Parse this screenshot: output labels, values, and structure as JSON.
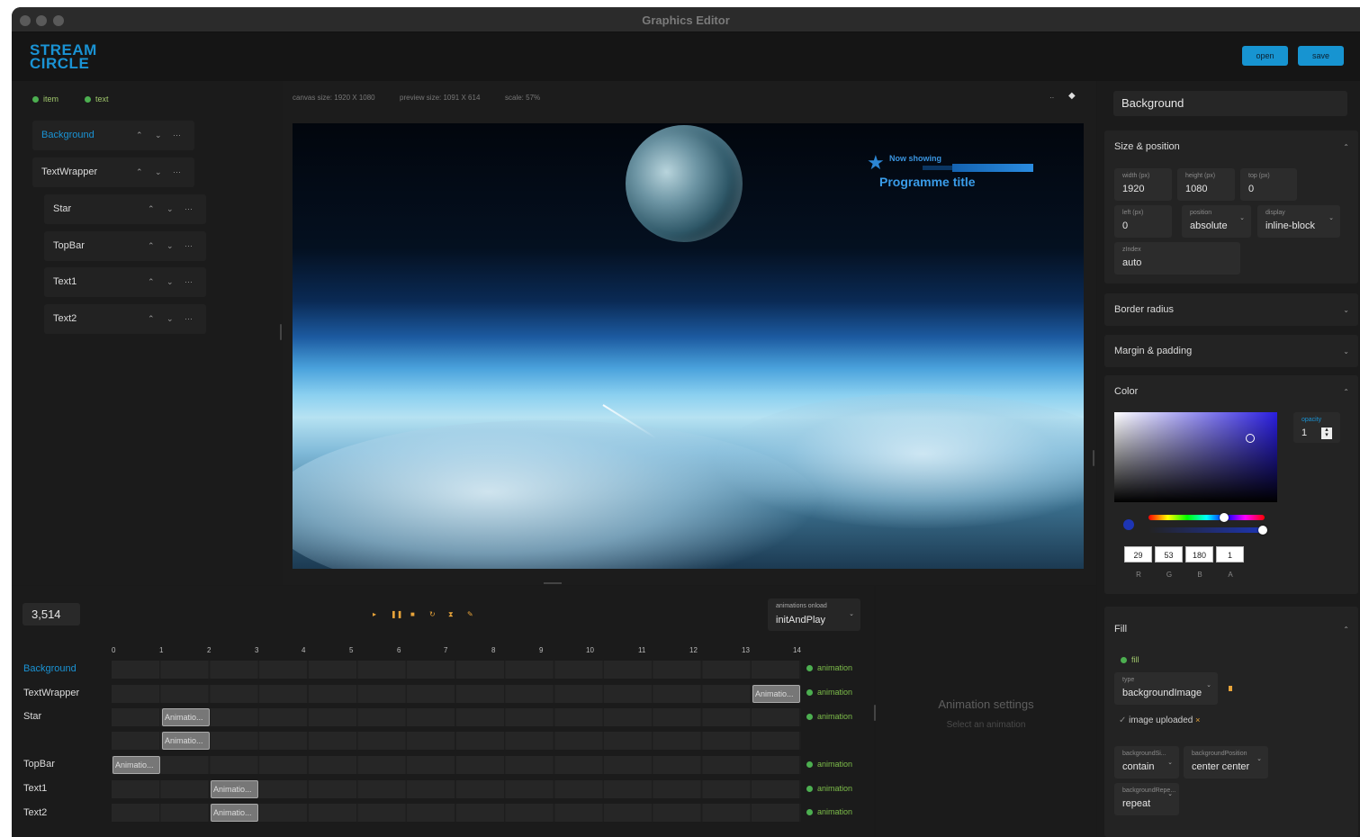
{
  "window": {
    "title": "Graphics Editor"
  },
  "header": {
    "logo_line1": "STREAM",
    "logo_line2": "CIRCLE",
    "open_label": "open",
    "save_label": "save"
  },
  "tree": {
    "add_item": "item",
    "add_text": "text",
    "items": [
      {
        "label": "Background",
        "selected": true
      },
      {
        "label": "TextWrapper"
      },
      {
        "label": "Star"
      },
      {
        "label": "TopBar"
      },
      {
        "label": "Text1"
      },
      {
        "label": "Text2"
      }
    ]
  },
  "preview": {
    "canvas_size": "canvas size: 1920 X 1080",
    "preview_size": "preview size: 1091 X 614",
    "scale": "scale: 57%",
    "overlay_now": "Now showing",
    "overlay_title": "Programme title"
  },
  "props": {
    "name": "Background",
    "size_position": {
      "title": "Size & position",
      "width": {
        "label": "width (px)",
        "value": "1920"
      },
      "height": {
        "label": "height (px)",
        "value": "1080"
      },
      "top": {
        "label": "top (px)",
        "value": "0"
      },
      "left": {
        "label": "left (px)",
        "value": "0"
      },
      "position": {
        "label": "position",
        "value": "absolute"
      },
      "display": {
        "label": "display",
        "value": "inline-block"
      },
      "zindex": {
        "label": "zIndex",
        "value": "auto"
      }
    },
    "border_radius": "Border radius",
    "margin_padding": "Margin & padding",
    "color": {
      "title": "Color",
      "opacity_label": "opacity",
      "opacity_value": "1",
      "r": "29",
      "g": "53",
      "b": "180",
      "a": "1",
      "labels": [
        "R",
        "G",
        "B",
        "A"
      ],
      "hex": "#1d35b4"
    },
    "fill": {
      "title": "Fill",
      "add_fill": "fill",
      "type": {
        "label": "type",
        "value": "backgroundImage"
      },
      "image_uploaded": "image uploaded",
      "bg_size": {
        "label": "backgroundSi...",
        "value": "contain"
      },
      "bg_position": {
        "label": "backgroundPosition",
        "value": "center center"
      },
      "bg_repeat": {
        "label": "backgroundRepe...",
        "value": "repeat"
      }
    }
  },
  "timeline": {
    "counter": "3,514",
    "onload_label": "animations onload",
    "onload_value": "initAndPlay",
    "ticks": [
      "0",
      "1",
      "2",
      "3",
      "4",
      "5",
      "6",
      "7",
      "8",
      "9",
      "10",
      "11",
      "12",
      "13",
      "14"
    ],
    "animation_label": "Animatio...",
    "add_animation": "animation",
    "rows": [
      {
        "label": "Background"
      },
      {
        "label": "TextWrapper"
      },
      {
        "label": "Star"
      },
      {
        "label": ""
      },
      {
        "label": "TopBar"
      },
      {
        "label": "Text1"
      },
      {
        "label": "Text2"
      }
    ]
  },
  "anim_settings": {
    "title": "Animation settings",
    "subtitle": "Select an animation"
  },
  "colors": {
    "accent": "#1a93d4",
    "button": "#1794d1",
    "add_green": "#4caf50",
    "control_orange": "#e8a43a"
  }
}
